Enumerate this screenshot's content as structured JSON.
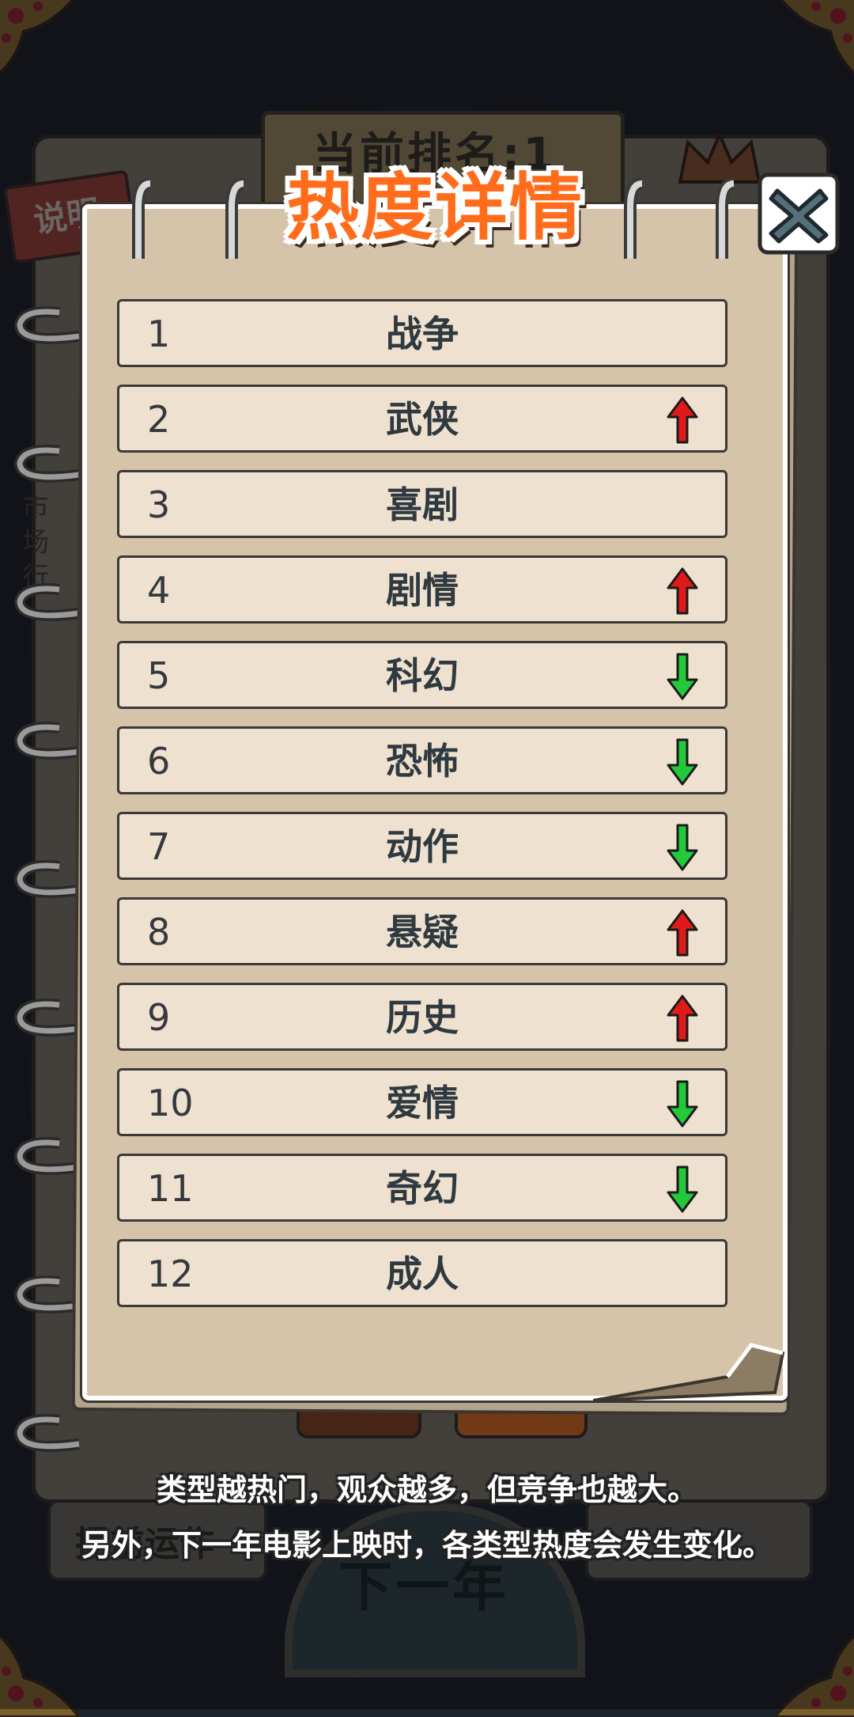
{
  "background": {
    "banner_text": "当前排名:1",
    "info_tag": "说明",
    "side_text": "市场行",
    "left_button": "提前运作",
    "right_button": "",
    "next_year": "下一年"
  },
  "dialog": {
    "title": "热度详情",
    "close_icon": "close-x-icon"
  },
  "colors": {
    "up": "#e01a1a",
    "down": "#22c93a",
    "title": "#ff6d1c"
  },
  "rankings": [
    {
      "rank": "1",
      "genre": "战争",
      "trend": "none"
    },
    {
      "rank": "2",
      "genre": "武侠",
      "trend": "up"
    },
    {
      "rank": "3",
      "genre": "喜剧",
      "trend": "none"
    },
    {
      "rank": "4",
      "genre": "剧情",
      "trend": "up"
    },
    {
      "rank": "5",
      "genre": "科幻",
      "trend": "down"
    },
    {
      "rank": "6",
      "genre": "恐怖",
      "trend": "down"
    },
    {
      "rank": "7",
      "genre": "动作",
      "trend": "down"
    },
    {
      "rank": "8",
      "genre": "悬疑",
      "trend": "up"
    },
    {
      "rank": "9",
      "genre": "历史",
      "trend": "up"
    },
    {
      "rank": "10",
      "genre": "爱情",
      "trend": "down"
    },
    {
      "rank": "11",
      "genre": "奇幻",
      "trend": "down"
    },
    {
      "rank": "12",
      "genre": "成人",
      "trend": "none"
    }
  ],
  "hint": {
    "line1": "类型越热门，观众越多，但竞争也越大。",
    "line2": "另外，下一年电影上映时，各类型热度会发生变化。"
  }
}
